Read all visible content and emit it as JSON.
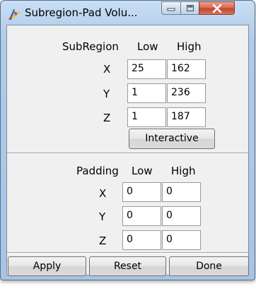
{
  "window": {
    "title": "Subregion-Pad Volu..."
  },
  "subregion": {
    "header": "SubRegion",
    "col_low": "Low",
    "col_high": "High",
    "rows": [
      {
        "axis": "X",
        "low": "25",
        "high": "162"
      },
      {
        "axis": "Y",
        "low": "1",
        "high": "236"
      },
      {
        "axis": "Z",
        "low": "1",
        "high": "187"
      }
    ],
    "interactive_label": "Interactive"
  },
  "padding": {
    "header": "Padding",
    "col_low": "Low",
    "col_high": "High",
    "rows": [
      {
        "axis": "X",
        "low": "0",
        "high": "0"
      },
      {
        "axis": "Y",
        "low": "0",
        "high": "0"
      },
      {
        "axis": "Z",
        "low": "0",
        "high": "0"
      }
    ]
  },
  "buttons": {
    "apply": "Apply",
    "reset": "Reset",
    "done": "Done"
  },
  "colors": {
    "titlebar": "#b9d2ec",
    "close_button": "#c5452c",
    "client_bg": "#f0f0f0"
  }
}
